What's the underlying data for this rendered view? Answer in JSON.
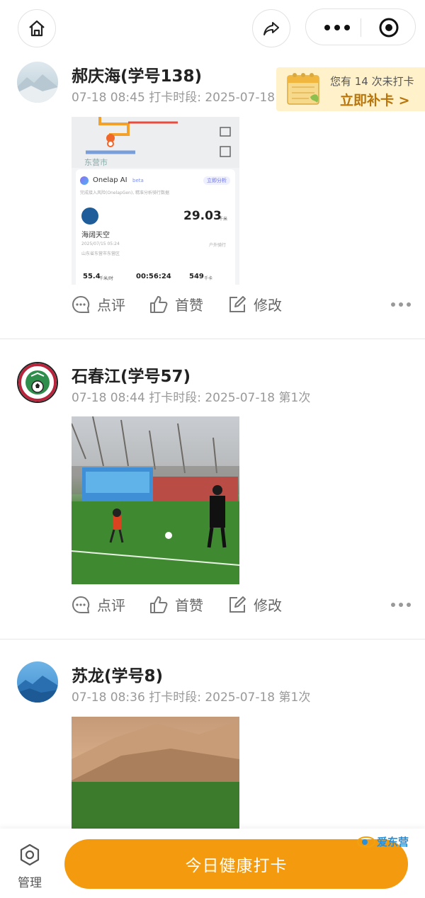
{
  "nav": {
    "home_icon": "home-icon",
    "share_icon": "share-icon",
    "more_icon": "more-dots-icon",
    "record_icon": "target-icon"
  },
  "banner": {
    "line1": "您有 14 次未打卡",
    "line2": "立即补卡 >"
  },
  "posts": [
    {
      "name": "郝庆海(学号138)",
      "meta": "07-18 08:45 打卡时段: 2025-07-18 第1次",
      "image": {
        "app_name": "Onelap AI",
        "app_tag": "beta",
        "analyze": "立即分析",
        "desc": "完成接入风险(OnelapGen), 精准分析骑行数据",
        "city": "东营市",
        "route_name": "海阔天空",
        "datetime": "2025/07/15 05:24",
        "location": "山东省东营市东营区",
        "distance": "29.03",
        "distance_unit": "千米",
        "ride_type": "户外骑行",
        "stat1": "55.4",
        "stat1_unit": "千米/时",
        "stat2": "00:56:24",
        "stat3": "549",
        "stat3_unit": "千卡"
      },
      "actions": {
        "comment": "点评",
        "like": "首赞",
        "edit": "修改"
      }
    },
    {
      "name": "石春江(学号57)",
      "meta": "07-18 08:44 打卡时段: 2025-07-18 第1次",
      "actions": {
        "comment": "点评",
        "like": "首赞",
        "edit": "修改"
      }
    },
    {
      "name": "苏龙(学号8)",
      "meta": "07-18 08:36 打卡时段: 2025-07-18 第1次"
    }
  ],
  "bottom": {
    "manage_label": "管理",
    "cta_label": "今日健康打卡",
    "watermark": "爱东营"
  }
}
